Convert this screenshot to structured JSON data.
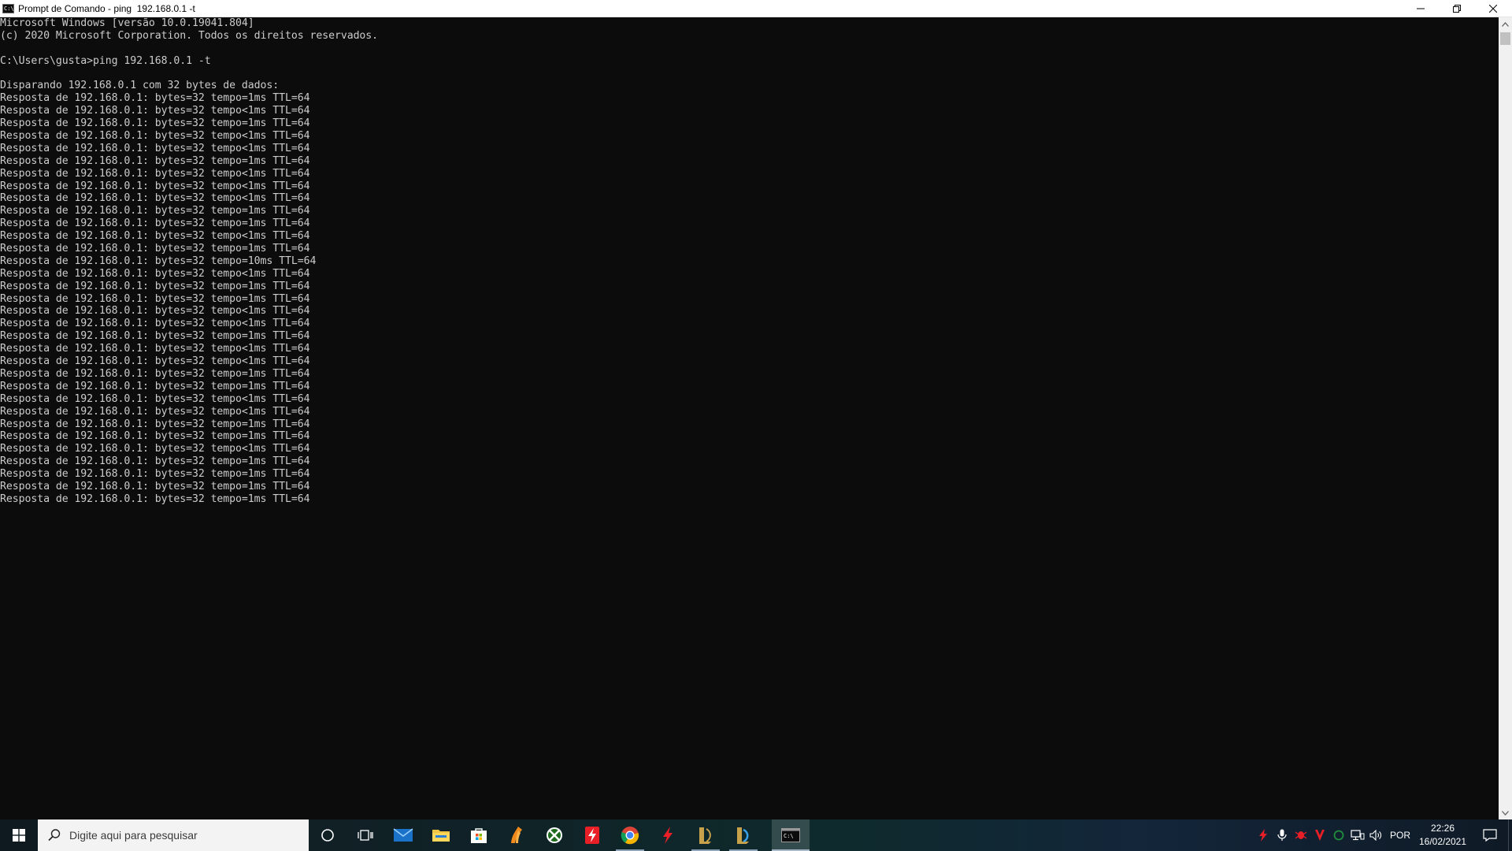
{
  "window": {
    "title": "Prompt de Comando - ping  192.168.0.1 -t",
    "icon_label": "C:\\",
    "buttons": [
      "minimize-icon",
      "restore-icon",
      "close-icon"
    ]
  },
  "console": {
    "lines": [
      "Microsoft Windows [versão 10.0.19041.804]",
      "(c) 2020 Microsoft Corporation. Todos os direitos reservados.",
      "",
      "C:\\Users\\gusta>ping 192.168.0.1 -t",
      "",
      "Disparando 192.168.0.1 com 32 bytes de dados:",
      "Resposta de 192.168.0.1: bytes=32 tempo=1ms TTL=64",
      "Resposta de 192.168.0.1: bytes=32 tempo<1ms TTL=64",
      "Resposta de 192.168.0.1: bytes=32 tempo=1ms TTL=64",
      "Resposta de 192.168.0.1: bytes=32 tempo<1ms TTL=64",
      "Resposta de 192.168.0.1: bytes=32 tempo<1ms TTL=64",
      "Resposta de 192.168.0.1: bytes=32 tempo=1ms TTL=64",
      "Resposta de 192.168.0.1: bytes=32 tempo<1ms TTL=64",
      "Resposta de 192.168.0.1: bytes=32 tempo<1ms TTL=64",
      "Resposta de 192.168.0.1: bytes=32 tempo<1ms TTL=64",
      "Resposta de 192.168.0.1: bytes=32 tempo=1ms TTL=64",
      "Resposta de 192.168.0.1: bytes=32 tempo=1ms TTL=64",
      "Resposta de 192.168.0.1: bytes=32 tempo<1ms TTL=64",
      "Resposta de 192.168.0.1: bytes=32 tempo=1ms TTL=64",
      "Resposta de 192.168.0.1: bytes=32 tempo=10ms TTL=64",
      "Resposta de 192.168.0.1: bytes=32 tempo<1ms TTL=64",
      "Resposta de 192.168.0.1: bytes=32 tempo=1ms TTL=64",
      "Resposta de 192.168.0.1: bytes=32 tempo=1ms TTL=64",
      "Resposta de 192.168.0.1: bytes=32 tempo<1ms TTL=64",
      "Resposta de 192.168.0.1: bytes=32 tempo<1ms TTL=64",
      "Resposta de 192.168.0.1: bytes=32 tempo=1ms TTL=64",
      "Resposta de 192.168.0.1: bytes=32 tempo<1ms TTL=64",
      "Resposta de 192.168.0.1: bytes=32 tempo<1ms TTL=64",
      "Resposta de 192.168.0.1: bytes=32 tempo=1ms TTL=64",
      "Resposta de 192.168.0.1: bytes=32 tempo=1ms TTL=64",
      "Resposta de 192.168.0.1: bytes=32 tempo<1ms TTL=64",
      "Resposta de 192.168.0.1: bytes=32 tempo<1ms TTL=64",
      "Resposta de 192.168.0.1: bytes=32 tempo=1ms TTL=64",
      "Resposta de 192.168.0.1: bytes=32 tempo=1ms TTL=64",
      "Resposta de 192.168.0.1: bytes=32 tempo<1ms TTL=64",
      "Resposta de 192.168.0.1: bytes=32 tempo=1ms TTL=64",
      "Resposta de 192.168.0.1: bytes=32 tempo=1ms TTL=64",
      "Resposta de 192.168.0.1: bytes=32 tempo=1ms TTL=64",
      "Resposta de 192.168.0.1: bytes=32 tempo=1ms TTL=64"
    ],
    "colors": {
      "background": "#0c0c0c",
      "text": "#cccccc"
    }
  },
  "scrollbar": {
    "up_icon": "scroll-up-arrow-icon",
    "down_icon": "scroll-down-arrow-icon"
  },
  "taskbar": {
    "start_icon": "windows-start-icon",
    "search": {
      "placeholder": "Digite aqui para pesquisar"
    },
    "pinned": [
      {
        "name": "cortana",
        "icon": "cortana-circle-icon"
      },
      {
        "name": "task-view",
        "icon": "task-view-icon"
      },
      {
        "name": "mail",
        "icon": "mail-icon"
      },
      {
        "name": "file-explorer",
        "icon": "folder-icon"
      },
      {
        "name": "store",
        "icon": "store-bag-icon"
      },
      {
        "name": "app-flame",
        "icon": "flame-icon"
      },
      {
        "name": "xbox",
        "icon": "xbox-icon"
      },
      {
        "name": "app-red-bolt",
        "icon": "red-bolt-square-icon"
      },
      {
        "name": "chrome",
        "icon": "chrome-icon"
      },
      {
        "name": "app-red-bolt-2",
        "icon": "red-bolt-icon"
      },
      {
        "name": "league-client",
        "icon": "league-icon"
      },
      {
        "name": "league-client-2",
        "icon": "league-icon-2"
      },
      {
        "name": "command-prompt",
        "icon": "terminal-icon"
      }
    ],
    "tray": {
      "icons": [
        "red-bolt-tray-icon",
        "microphone-icon",
        "red-bug-icon",
        "red-antivirus-icon",
        "green-circle-icon",
        "network-icon",
        "volume-icon"
      ],
      "language": "POR",
      "time": "22:26",
      "date": "16/02/2021",
      "notification_icon": "notification-icon"
    },
    "colors": {
      "accent_indicator": "#8fa3b8",
      "red_icons": "#e81f27"
    }
  }
}
